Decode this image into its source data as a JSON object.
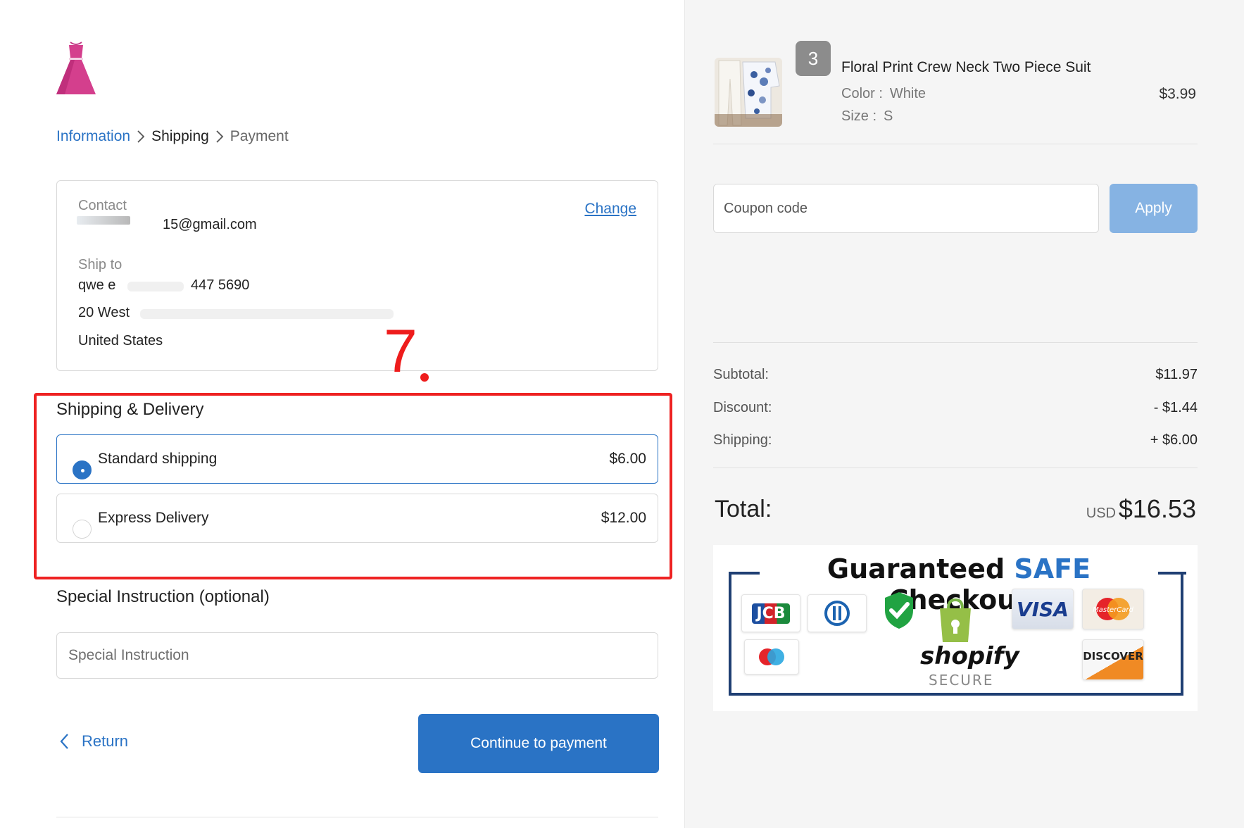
{
  "breadcrumb": {
    "information": "Information",
    "shipping": "Shipping",
    "payment": "Payment"
  },
  "contact": {
    "label": "Contact",
    "email": "15@gmail.com",
    "change": "Change"
  },
  "ship_to": {
    "label": "Ship to",
    "name_phone_visible": "qwe  e",
    "phone_tail": "447 5690",
    "address_line": "20 West",
    "country": "United States"
  },
  "annotation": {
    "number": "7"
  },
  "shipping_delivery": {
    "title": "Shipping & Delivery",
    "options": [
      {
        "name": "Standard shipping",
        "price": "$6.00",
        "selected": true
      },
      {
        "name": "Express Delivery",
        "price": "$12.00",
        "selected": false
      }
    ]
  },
  "special_instruction": {
    "title": "Special Instruction (optional)",
    "placeholder": "Special Instruction"
  },
  "actions": {
    "return": "Return",
    "continue": "Continue to payment"
  },
  "cart": {
    "item": {
      "quantity": "3",
      "name": "Floral Print Crew Neck Two Piece Suit",
      "color_label": "Color :",
      "color": "White",
      "size_label": "Size :",
      "size": "S",
      "price": "$3.99"
    },
    "coupon_placeholder": "Coupon code",
    "apply": "Apply",
    "subtotal_label": "Subtotal:",
    "subtotal": "$11.97",
    "discount_label": "Discount:",
    "discount": "- $1.44",
    "shipping_label": "Shipping:",
    "shipping": "+ $6.00",
    "total_label": "Total:",
    "currency": "USD",
    "total": "$16.53"
  },
  "trust_badge": {
    "title_a": "Guaranteed ",
    "title_b": "SAFE",
    "title_c": " Checkout",
    "brand": "shopify",
    "secure": "SECURE",
    "cards": [
      "JCB",
      "Diners Club",
      "Verified",
      "VISA",
      "MasterCard",
      "Maestro",
      "DISCOVER"
    ],
    "card_labels": {
      "jcb": "JCB",
      "visa": "VISA",
      "mastercard": "MasterCard",
      "discover": "DISCOVER"
    }
  },
  "colors": {
    "accent": "#2a73c5",
    "apply_button": "#86b3e3",
    "annotation_red": "#ee2222",
    "right_panel_bg": "#f5f5f5"
  }
}
